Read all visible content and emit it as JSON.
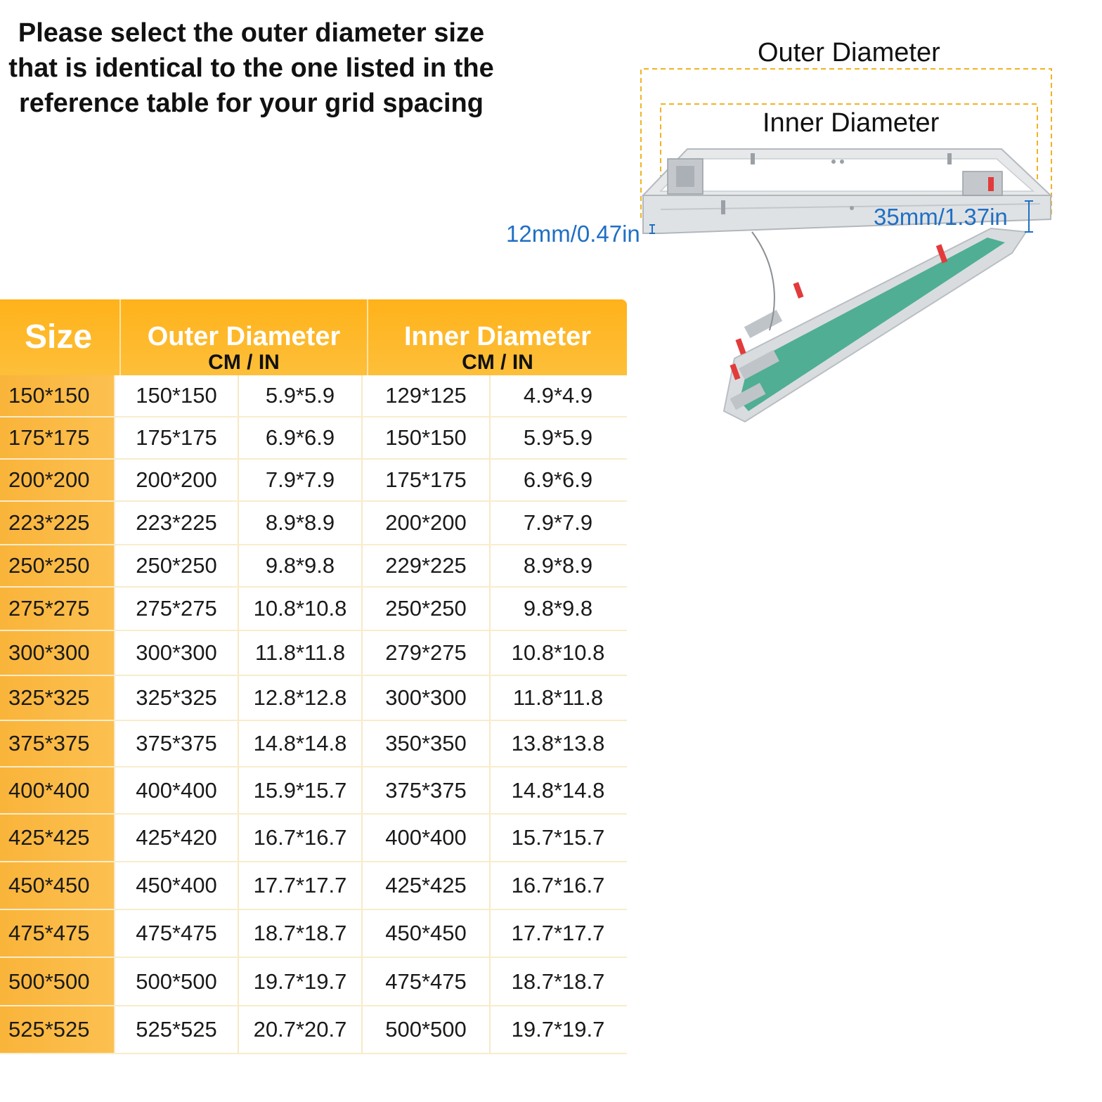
{
  "instruction": {
    "lines": [
      "Please select the outer diameter size",
      "that is identical to the one listed in the",
      "reference table for your grid spacing"
    ]
  },
  "illustration": {
    "outer_label": "Outer Diameter",
    "inner_label": "Inner Diameter",
    "depth_left": "12mm/0.47in",
    "depth_right": "35mm/1.37in"
  },
  "colors": {
    "header_orange": "#ffb21a",
    "size_column_orange": "#f9b43a",
    "measurement_blue": "#1f6fc4",
    "panel_green": "#4fae93",
    "clip_red": "#e23b3b"
  },
  "table": {
    "headers": {
      "size": "Size",
      "outer": "Outer Diameter",
      "outer_unit": "CM / IN",
      "inner": "Inner Diameter",
      "inner_unit": "CM / IN"
    },
    "rows": [
      {
        "size": "150*150",
        "outer_cm": "150*150",
        "outer_in": "5.9*5.9",
        "inner_cm": "129*125",
        "inner_in": "4.9*4.9"
      },
      {
        "size": "175*175",
        "outer_cm": "175*175",
        "outer_in": "6.9*6.9",
        "inner_cm": "150*150",
        "inner_in": "5.9*5.9"
      },
      {
        "size": "200*200",
        "outer_cm": "200*200",
        "outer_in": "7.9*7.9",
        "inner_cm": "175*175",
        "inner_in": "6.9*6.9"
      },
      {
        "size": "223*225",
        "outer_cm": "223*225",
        "outer_in": "8.9*8.9",
        "inner_cm": "200*200",
        "inner_in": "7.9*7.9"
      },
      {
        "size": "250*250",
        "outer_cm": "250*250",
        "outer_in": "9.8*9.8",
        "inner_cm": "229*225",
        "inner_in": "8.9*8.9"
      },
      {
        "size": "275*275",
        "outer_cm": "275*275",
        "outer_in": "10.8*10.8",
        "inner_cm": "250*250",
        "inner_in": "9.8*9.8"
      },
      {
        "size": "300*300",
        "outer_cm": "300*300",
        "outer_in": "11.8*11.8",
        "inner_cm": "279*275",
        "inner_in": "10.8*10.8"
      },
      {
        "size": "325*325",
        "outer_cm": "325*325",
        "outer_in": "12.8*12.8",
        "inner_cm": "300*300",
        "inner_in": "11.8*11.8"
      },
      {
        "size": "375*375",
        "outer_cm": "375*375",
        "outer_in": "14.8*14.8",
        "inner_cm": "350*350",
        "inner_in": "13.8*13.8"
      },
      {
        "size": "400*400",
        "outer_cm": "400*400",
        "outer_in": "15.9*15.7",
        "inner_cm": "375*375",
        "inner_in": "14.8*14.8"
      },
      {
        "size": "425*425",
        "outer_cm": "425*420",
        "outer_in": "16.7*16.7",
        "inner_cm": "400*400",
        "inner_in": "15.7*15.7"
      },
      {
        "size": "450*450",
        "outer_cm": "450*400",
        "outer_in": "17.7*17.7",
        "inner_cm": "425*425",
        "inner_in": "16.7*16.7"
      },
      {
        "size": "475*475",
        "outer_cm": "475*475",
        "outer_in": "18.7*18.7",
        "inner_cm": "450*450",
        "inner_in": "17.7*17.7"
      },
      {
        "size": "500*500",
        "outer_cm": "500*500",
        "outer_in": "19.7*19.7",
        "inner_cm": "475*475",
        "inner_in": "18.7*18.7"
      },
      {
        "size": "525*525",
        "outer_cm": "525*525",
        "outer_in": "20.7*20.7",
        "inner_cm": "500*500",
        "inner_in": "19.7*19.7"
      }
    ]
  }
}
